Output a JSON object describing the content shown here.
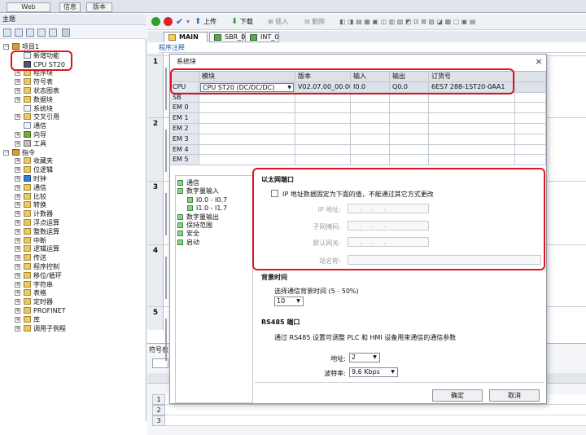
{
  "top_tabs": [
    "Web",
    "信息",
    "版本"
  ],
  "left_pane": {
    "header": "主题",
    "tree": [
      {
        "label": "项目1",
        "level": 0,
        "expander": "⊟",
        "icon": "project"
      },
      {
        "label": "新增功能",
        "level": 1,
        "icon": "doc"
      },
      {
        "label": "CPU ST20",
        "level": 1,
        "icon": "cpu"
      },
      {
        "label": "程序块",
        "level": 1,
        "expander": "⊞",
        "icon": "folder"
      },
      {
        "label": "符号表",
        "level": 1,
        "expander": "⊞",
        "icon": "folder"
      },
      {
        "label": "状态图表",
        "level": 1,
        "expander": "⊞",
        "icon": "folder"
      },
      {
        "label": "数据块",
        "level": 1,
        "expander": "⊞",
        "icon": "folder"
      },
      {
        "label": "系统块",
        "level": 1,
        "icon": "doc"
      },
      {
        "label": "交叉引用",
        "level": 1,
        "expander": "⊞",
        "icon": "folder"
      },
      {
        "label": "通信",
        "level": 1,
        "icon": "doc"
      },
      {
        "label": "向导",
        "level": 1,
        "expander": "⊞",
        "icon": "wizard"
      },
      {
        "label": "工具",
        "level": 1,
        "expander": "⊞",
        "icon": "tool"
      },
      {
        "label": "指令",
        "level": 0,
        "expander": "⊟",
        "icon": "project"
      },
      {
        "label": "收藏夹",
        "level": 1,
        "expander": "⊞",
        "icon": "folder"
      },
      {
        "label": "位逻辑",
        "level": 1,
        "expander": "⊞",
        "icon": "folder"
      },
      {
        "label": "时钟",
        "level": 1,
        "expander": "⊞",
        "icon": "clock"
      },
      {
        "label": "通信",
        "level": 1,
        "expander": "⊞",
        "icon": "folder"
      },
      {
        "label": "比较",
        "level": 1,
        "expander": "⊞",
        "icon": "folder"
      },
      {
        "label": "转换",
        "level": 1,
        "expander": "⊞",
        "icon": "folder"
      },
      {
        "label": "计数器",
        "level": 1,
        "expander": "⊞",
        "icon": "folder"
      },
      {
        "label": "浮点运算",
        "level": 1,
        "expander": "⊞",
        "icon": "folder"
      },
      {
        "label": "整数运算",
        "level": 1,
        "expander": "⊞",
        "icon": "folder"
      },
      {
        "label": "中断",
        "level": 1,
        "expander": "⊞",
        "icon": "folder"
      },
      {
        "label": "逻辑运算",
        "level": 1,
        "expander": "⊞",
        "icon": "folder"
      },
      {
        "label": "传送",
        "level": 1,
        "expander": "⊞",
        "icon": "folder"
      },
      {
        "label": "程序控制",
        "level": 1,
        "expander": "⊞",
        "icon": "folder"
      },
      {
        "label": "移位/循环",
        "level": 1,
        "expander": "⊞",
        "icon": "folder"
      },
      {
        "label": "字符串",
        "level": 1,
        "expander": "⊞",
        "icon": "folder"
      },
      {
        "label": "表格",
        "level": 1,
        "expander": "⊞",
        "icon": "folder"
      },
      {
        "label": "定时器",
        "level": 1,
        "expander": "⊞",
        "icon": "folder"
      },
      {
        "label": "PROFINET",
        "level": 1,
        "expander": "⊞",
        "icon": "folder"
      },
      {
        "label": "库",
        "level": 1,
        "expander": "⊞",
        "icon": "folder"
      },
      {
        "label": "调用子例程",
        "level": 1,
        "expander": "⊞",
        "icon": "folder"
      }
    ]
  },
  "toolbar": {
    "upload": "上传",
    "download": "下载",
    "insert": "插入",
    "delete": "删除"
  },
  "program_tabs": [
    "MAIN",
    "SBR_0",
    "INT_0"
  ],
  "program_comment": "程序注释",
  "networks": [
    "1",
    "2",
    "3",
    "4",
    "5"
  ],
  "symbol_table": {
    "title": "符号表",
    "rows": [
      "1",
      "2",
      "3"
    ]
  },
  "dialog": {
    "title": "系统块",
    "close": "×",
    "columns": [
      "模块",
      "版本",
      "输入",
      "输出",
      "订货号"
    ],
    "rows": [
      {
        "slot": "CPU",
        "module": "CPU ST20 (DC/DC/DC)",
        "version": "V02.07.00_00.00...",
        "input": "I0.0",
        "output": "Q0.0",
        "order": "6ES7 288-1ST20-0AA1"
      },
      {
        "slot": "SB",
        "module": "",
        "version": "",
        "input": "",
        "output": "",
        "order": ""
      },
      {
        "slot": "EM 0",
        "module": "",
        "version": "",
        "input": "",
        "output": "",
        "order": ""
      },
      {
        "slot": "EM 1",
        "module": "",
        "version": "",
        "input": "",
        "output": "",
        "order": ""
      },
      {
        "slot": "EM 2",
        "module": "",
        "version": "",
        "input": "",
        "output": "",
        "order": ""
      },
      {
        "slot": "EM 3",
        "module": "",
        "version": "",
        "input": "",
        "output": "",
        "order": ""
      },
      {
        "slot": "EM 4",
        "module": "",
        "version": "",
        "input": "",
        "output": "",
        "order": ""
      },
      {
        "slot": "EM 5",
        "module": "",
        "version": "",
        "input": "",
        "output": "",
        "order": ""
      }
    ],
    "nav": [
      {
        "label": "通信",
        "indent": 0
      },
      {
        "label": "数字量输入",
        "indent": 0
      },
      {
        "label": "I0.0 - I0.7",
        "indent": 1
      },
      {
        "label": "I1.0 - I1.7",
        "indent": 1
      },
      {
        "label": "数字量输出",
        "indent": 0
      },
      {
        "label": "保持范围",
        "indent": 0
      },
      {
        "label": "安全",
        "indent": 0
      },
      {
        "label": "启动",
        "indent": 0
      }
    ],
    "ethernet": {
      "title": "以太网端口",
      "checkbox_label": "IP 地址数据固定为下面的值，不能通过其它方式更改",
      "ip_label": "IP 地址:",
      "subnet_label": "子网掩码:",
      "gateway_label": "默认网关:",
      "station_label": "站名称:",
      "ip_placeholder": "...",
      "subnet_placeholder": "...",
      "gateway_placeholder": "..."
    },
    "background": {
      "title": "背景时间",
      "label": "选择通信背景时间 (5 - 50%)",
      "value": "10"
    },
    "rs485": {
      "title": "RS485 端口",
      "desc": "通过 RS485 设置可调整 PLC 和 HMI 设备用来通信的通信参数",
      "address_label": "地址:",
      "address_value": "2",
      "baud_label": "波特率:",
      "baud_value": "9.6 Kbps"
    },
    "ok": "确定",
    "cancel": "取消"
  },
  "colors": {
    "annotation_red": "#e0141e",
    "run_green": "#2e9e2e",
    "stop_red": "#d8262b"
  }
}
